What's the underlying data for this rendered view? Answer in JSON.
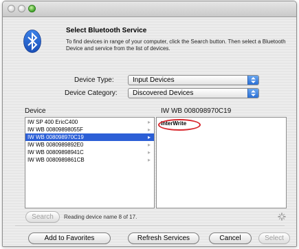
{
  "header": {
    "title": "Select Bluetooth Service",
    "description": "To find devices in range of your computer, click the Search button. Then select a Bluetooth Device and service from the list of devices."
  },
  "filters": {
    "device_type_label": "Device Type:",
    "device_type_value": "Input Devices",
    "device_category_label": "Device Category:",
    "device_category_value": "Discovered Devices"
  },
  "devices": {
    "column_label": "Device",
    "items": [
      "IW SP 400 EricC400",
      "IW WB 00809898055F",
      "IW WB 008098970C19",
      "IW WB 0080989892E0",
      "IW WB 00809898941C",
      "IW WB 0080989861CB"
    ],
    "selected_index": 2
  },
  "services": {
    "column_label": "IW WB 008098970C19",
    "items": [
      "InterWrite"
    ]
  },
  "search": {
    "button_label": "Search",
    "status": "Reading device name 8 of 17."
  },
  "footer": {
    "add_favorites": "Add to Favorites",
    "refresh": "Refresh Services",
    "cancel": "Cancel",
    "select": "Select"
  },
  "colors": {
    "selection": "#2c5fd6",
    "annotation": "#d8262c",
    "bluetooth": "#1e5fd0"
  },
  "icons": {
    "window": [
      "close-icon",
      "minimize-icon",
      "zoom-icon"
    ],
    "app": "bluetooth-icon",
    "popup": "up-down-arrows-icon",
    "status": "spinner-icon"
  }
}
